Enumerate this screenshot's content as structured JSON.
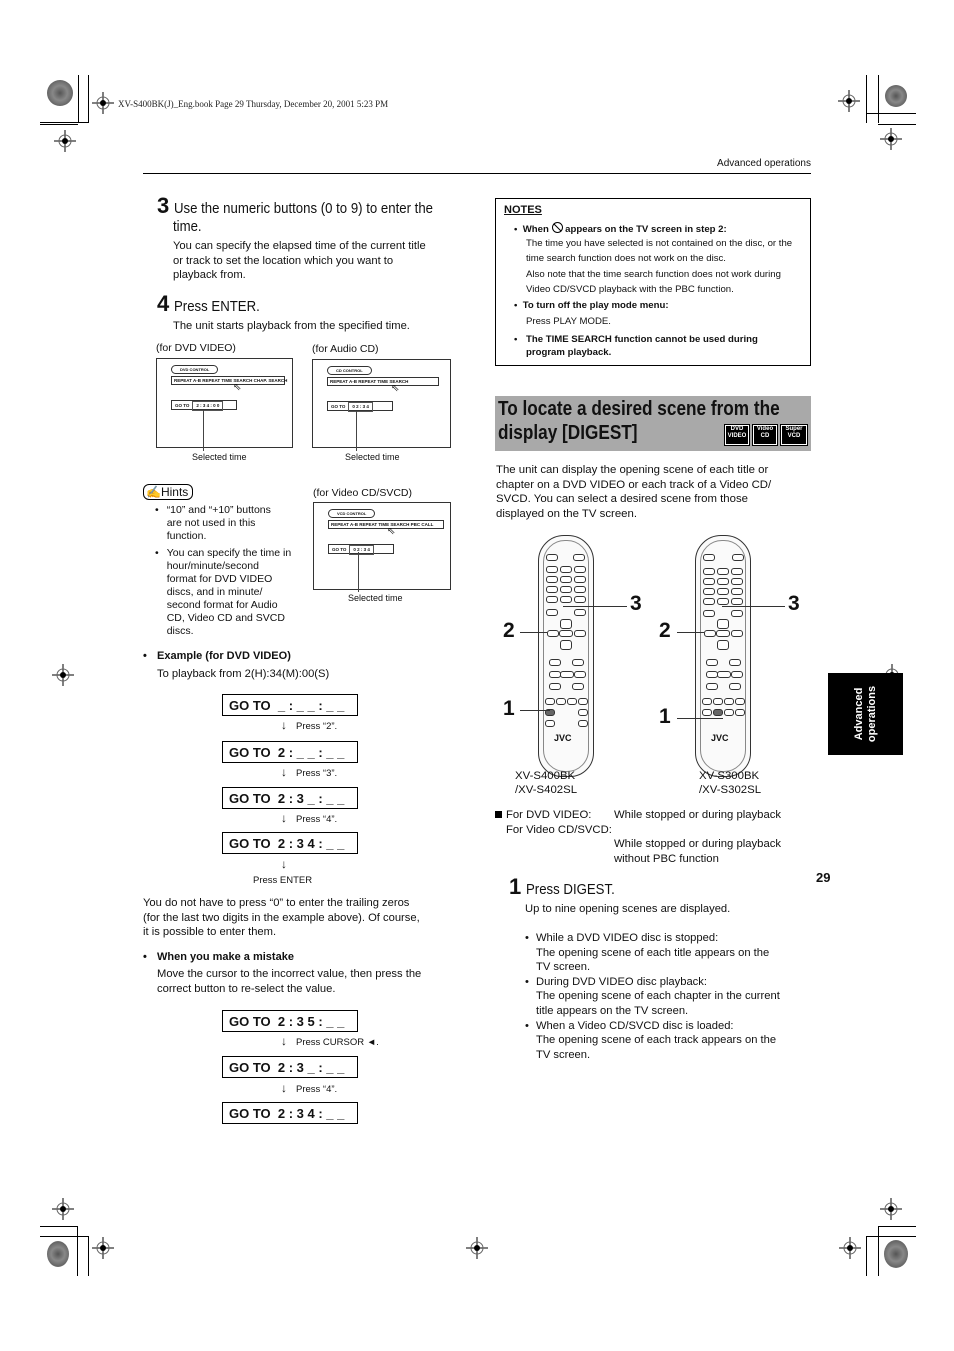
{
  "print_info": "XV-S400BK(J)_Eng.book  Page 29  Thursday, December 20, 2001  5:23 PM",
  "header": {
    "section": "Advanced operations"
  },
  "page_number": "29",
  "side_tab": {
    "line1": "Advanced",
    "line2": "operations"
  },
  "left": {
    "step3": {
      "num": "3",
      "title_line1": "Use the numeric buttons (0 to 9) to enter the",
      "title_line2": "time.",
      "body": [
        "You can specify the elapsed time of the current title",
        "or track to set the location which you want to",
        "playback from."
      ]
    },
    "step4": {
      "num": "4",
      "title": "Press ENTER.",
      "body": "The unit starts playback from the specified time."
    },
    "screens": [
      {
        "caption": "(for DVD VIDEO)",
        "control": "DVD CONTROL",
        "menu": "REPEAT   A-B REPEAT   TIME SEARCH   CHAP. SEARCH",
        "goto": "GO TO",
        "time": "2 : 3 4 : 0 0",
        "selected_label": "Selected time"
      },
      {
        "caption": "(for Audio CD)",
        "control": "CD CONTROL",
        "menu": "REPEAT   A-B REPEAT   TIME SEARCH",
        "goto": "GO TO",
        "time": "0 2 : 3 4",
        "selected_label": "Selected time"
      },
      {
        "caption": "(for Video CD/SVCD)",
        "control": "VCD CONTROL",
        "menu": "REPEAT   A-B REPEAT   TIME SEARCH   PBC CALL",
        "goto": "GO TO",
        "time": "0 2 : 3 4",
        "selected_label": "Selected time"
      }
    ],
    "hints": {
      "label": "Hints",
      "items": [
        [
          "“10” and “+10” buttons",
          "are not used in this",
          "function."
        ],
        [
          "You can specify the time in",
          "hour/minute/second",
          "format for DVD VIDEO",
          "discs, and in minute/",
          "second format for Audio",
          "CD, Video CD and SVCD",
          "discs."
        ]
      ]
    },
    "example": {
      "title": "Example (for DVD VIDEO)",
      "subtitle": "To playback from 2(H):34(M):00(S)",
      "steps": [
        {
          "display": "GO TO  _ : _ _ : _ _",
          "press": "Press “2”."
        },
        {
          "display": "GO TO  2 : _ _ : _ _",
          "press": "Press “3”."
        },
        {
          "display": "GO TO  2 : 3 _ : _ _",
          "press": "Press “4”."
        },
        {
          "display": "GO TO  2 : 3 4 : _ _",
          "press": "Press ENTER"
        }
      ]
    },
    "trailing_note": [
      "You do not have to press “0” to enter the trailing zeros",
      "(for the last two digits in the example above). Of course,",
      "it is possible to enter them."
    ],
    "mistake": {
      "title": "When you make a mistake",
      "body": [
        "Move the cursor to the incorrect value, then press the",
        "correct button to re-select the value."
      ],
      "steps": [
        {
          "display": "GO TO  2 : 3 5 : _ _",
          "press": "Press CURSOR ◄."
        },
        {
          "display": "GO TO  2 : 3 _ : _ _",
          "press": "Press “4”."
        },
        {
          "display": "GO TO  2 : 3 4 : _ _",
          "press": ""
        }
      ]
    }
  },
  "notes": {
    "heading": "NOTES",
    "item1_title_a": "When",
    "item1_title_b": "appears on the TV screen in step 2:",
    "item1_body1": "The time you have selected is not contained on the disc, or the time search function does not work on the disc.",
    "item1_body2": "Also note that the time search function does not work during Video CD/SVCD playback with the PBC function.",
    "item2_title": "To turn off the play mode menu:",
    "item2_body": "Press PLAY MODE.",
    "item3_title": "The TIME SEARCH function cannot be used during program playback."
  },
  "digest": {
    "title_line1": "To locate a desired scene from the",
    "title_line2": "display [DIGEST]",
    "badges": [
      {
        "top": "DVD",
        "bottom": "VIDEO"
      },
      {
        "top": "Video",
        "bottom": "CD"
      },
      {
        "top": "Super",
        "bottom": "VCD"
      }
    ],
    "intro": [
      "The unit can display the opening scene of each title or",
      "chapter on a DVD VIDEO or each track of a Video CD/",
      "SVCD.  You can select a desired scene from those",
      "displayed on the TV screen."
    ],
    "remotes": [
      {
        "model_line1": "XV-S400BK",
        "model_line2": "/XV-S402SL",
        "brand": "JVC",
        "callouts": [
          "1",
          "2",
          "3"
        ]
      },
      {
        "model_line1": "XV-S300BK",
        "model_line2": "/XV-S302SL",
        "brand": "JVC",
        "callouts": [
          "1",
          "2",
          "3"
        ]
      }
    ],
    "conditions": {
      "dvd_label": "For DVD VIDEO:",
      "dvd_value": "While stopped or during playback",
      "vcd_label": "For Video CD/SVCD:",
      "vcd_value_1": "While stopped or during playback",
      "vcd_value_2": "without PBC function"
    },
    "step1": {
      "num": "1",
      "title": "Press DIGEST.",
      "body": "Up to nine opening scenes are displayed.",
      "bullets": [
        {
          "head": "While a DVD VIDEO disc is stopped:",
          "lines": [
            "The opening scene of each title appears on the",
            "TV screen."
          ]
        },
        {
          "head": "During DVD VIDEO disc playback:",
          "lines": [
            "The opening scene of each chapter in the current",
            "title appears on the TV screen."
          ]
        },
        {
          "head": "When a Video CD/SVCD disc is loaded:",
          "lines": [
            "The opening scene of each track appears on the",
            "TV screen."
          ]
        }
      ]
    }
  }
}
